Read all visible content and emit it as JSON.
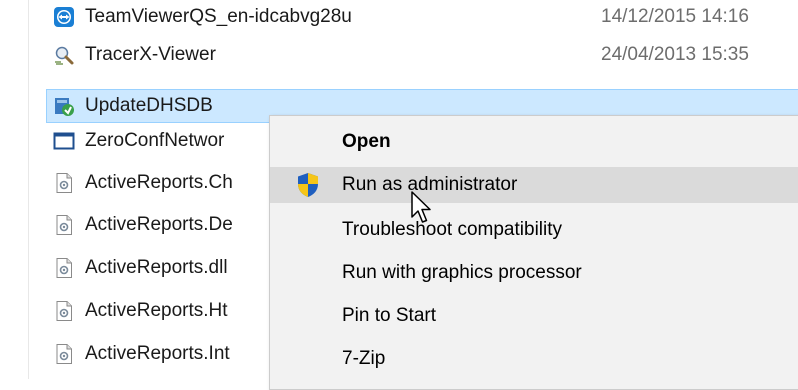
{
  "files": [
    {
      "name": "TeamViewerQS_en-idcabvg28u",
      "date": "14/12/2015 14:16",
      "icon": "teamviewer-icon"
    },
    {
      "name": "TracerX-Viewer",
      "date": "24/04/2013 15:35",
      "icon": "tracer-icon"
    },
    {
      "name": "UpdateDHSDB",
      "date": "",
      "icon": "update-installer-icon",
      "selected": true
    },
    {
      "name": "ZeroConfNetwor",
      "date": "",
      "icon": "window-icon"
    },
    {
      "name": "ActiveReports.Ch",
      "date": "",
      "icon": "config-file-icon"
    },
    {
      "name": "ActiveReports.De",
      "date": "",
      "icon": "config-file-icon"
    },
    {
      "name": "ActiveReports.dll",
      "date": "",
      "icon": "config-file-icon"
    },
    {
      "name": "ActiveReports.Ht",
      "date": "",
      "icon": "config-file-icon"
    },
    {
      "name": "ActiveReports.Int",
      "date": "",
      "icon": "config-file-icon"
    }
  ],
  "context_menu": {
    "items": [
      {
        "label": "Open",
        "bold": true
      },
      {
        "label": "Run as administrator",
        "icon": "uac-shield-icon",
        "hovered": true
      },
      {
        "label": "Troubleshoot compatibility"
      },
      {
        "label": "Run with graphics processor"
      },
      {
        "label": "Pin to Start"
      },
      {
        "label": "7-Zip"
      }
    ]
  }
}
